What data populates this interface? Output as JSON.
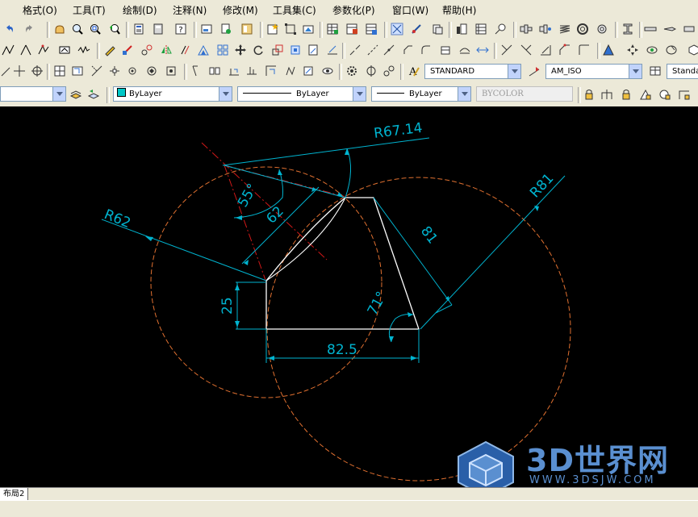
{
  "menu": [
    "格式(O)",
    "工具(T)",
    "绘制(D)",
    "注释(N)",
    "修改(M)",
    "工具集(C)",
    "参数化(P)",
    "窗口(W)",
    "帮助(H)"
  ],
  "toolbar": {
    "text_style": "STANDARD",
    "dim_style": "AM_ISO",
    "table_style": "Standa",
    "color": "ByLayer",
    "linetype": "ByLayer",
    "lineweight": "ByLayer",
    "plot_style": "BYCOLOR"
  },
  "drawing": {
    "dim_r6714": "R67.14",
    "dim_r62": "R62",
    "dim_r81": "R81",
    "dim_55": "55°",
    "dim_62": "62",
    "dim_81": "81",
    "dim_25": "25",
    "dim_71": "71°",
    "dim_825": "82.5"
  },
  "layout_tab": "布局2",
  "watermark": {
    "brand": "3D世界网",
    "url": "WWW.3DSJW.COM"
  },
  "colors": {
    "dim": "#00b4d0",
    "construction": "#e07030",
    "center": "#d01818",
    "geometry": "#ffffff"
  }
}
